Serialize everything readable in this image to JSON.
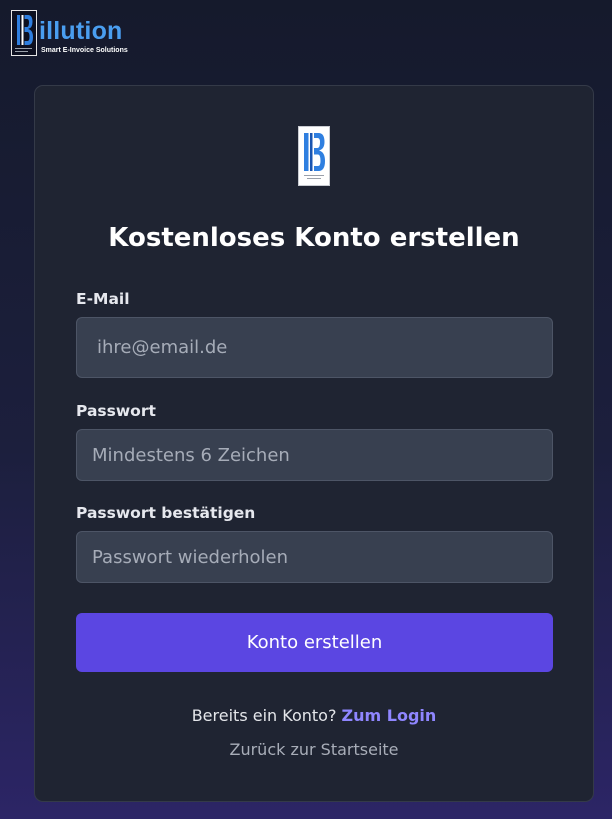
{
  "brand": {
    "name": "illution",
    "tagline": "Smart E-Invoice Solutions",
    "logo_icon": "billution-b-logo-icon"
  },
  "card": {
    "logo_icon": "billution-b-logo-icon",
    "title": "Kostenloses Konto erstellen"
  },
  "form": {
    "email": {
      "label": "E-Mail",
      "placeholder": "ihre@email.de",
      "value": ""
    },
    "password": {
      "label": "Passwort",
      "placeholder": "Mindestens 6 Zeichen",
      "value": ""
    },
    "confirm_password": {
      "label": "Passwort bestätigen",
      "placeholder": "Passwort wiederholen",
      "value": ""
    },
    "submit_label": "Konto erstellen"
  },
  "footer": {
    "login_prompt": "Bereits ein Konto?",
    "login_link": "Zum Login",
    "home_link": "Zurück zur Startseite"
  },
  "colors": {
    "accent": "#5b46e2",
    "link": "#8f86ff",
    "brand_blue": "#4a9ef0",
    "card_bg": "#1f2432",
    "input_bg": "#384050"
  }
}
